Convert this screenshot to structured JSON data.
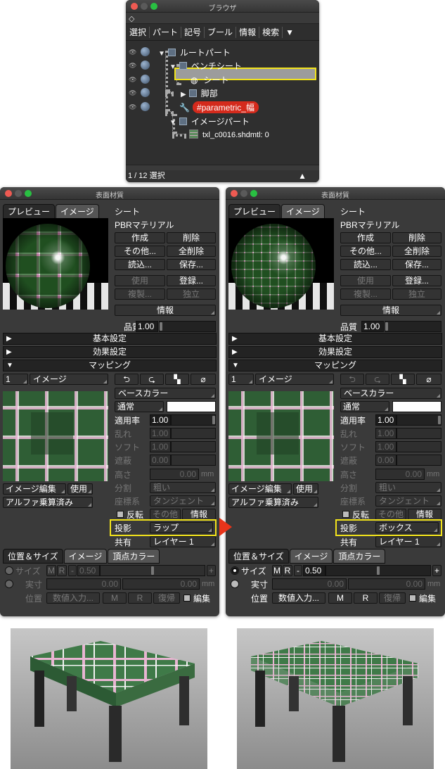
{
  "browser": {
    "title": "ブラウザ",
    "menu": [
      "選択",
      "パート",
      "記号",
      "ブール",
      "情報",
      "検索"
    ],
    "tree": {
      "root": "ルートパート",
      "bench": "ベンチシート",
      "sheet": "シート",
      "legs": "脚部",
      "param": "#parametric_幅",
      "image_part": "イメージパート",
      "texture": "txl_c0016.shdmtl: 0"
    },
    "status": "1 / 12 選択"
  },
  "left": {
    "title": "表面材質",
    "tabs": [
      "プレビュー",
      "イメージ"
    ],
    "mat_name": "シート",
    "mat_type": "PBRマテリアル",
    "btn": {
      "create": "作成",
      "delete": "削除",
      "other": "その他...",
      "delete_all": "全削除",
      "load": "読込...",
      "save": "保存...",
      "use": "使用",
      "register": "登録...",
      "dup": "複製...",
      "indep": "独立",
      "info": "情報"
    },
    "quality_label": "品質",
    "quality_value": "1.00",
    "sections": {
      "basic": "基本設定",
      "effect": "効果設定",
      "mapping": "マッピング"
    },
    "map_index": "1",
    "map_type": "イメージ",
    "base_color": "ベースカラー",
    "blend": "通常",
    "rows": {
      "apply": "適用率",
      "noise": "乱れ",
      "soft": "ソフト",
      "occlude": "遮蔽",
      "height": "高さ",
      "split": "分割",
      "coord": "座標系"
    },
    "values": {
      "apply": "1.00",
      "noise": "1.00",
      "soft": "1.00",
      "occlude": "0.00",
      "height": "0.00",
      "unit": "mm"
    },
    "split_val": "粗い",
    "coord_val": "タンジェント",
    "img_edit": "イメージ編集",
    "use": "使用",
    "alpha": "アルファ乗算済み",
    "invert": "反転",
    "other": "その他",
    "info": "情報",
    "projection_label": "投影",
    "projection": "ラップ",
    "share_label": "共有",
    "layer": "レイヤー 1",
    "bottom_tabs": [
      "位置＆サイズ",
      "イメージ",
      "頂点カラー"
    ],
    "size_label": "サイズ",
    "m": "M",
    "r": "R",
    "minus": "-",
    "size_value": "0.50",
    "plus": "+",
    "actual_label": "実寸",
    "actual1": "0.00",
    "actual2": "0.00",
    "unit": "mm",
    "pos_label": "位置",
    "numeric_input": "数値入力...",
    "reset": "復帰",
    "edit": "編集"
  },
  "right": {
    "title": "表面材質",
    "projection": "ボックス"
  }
}
